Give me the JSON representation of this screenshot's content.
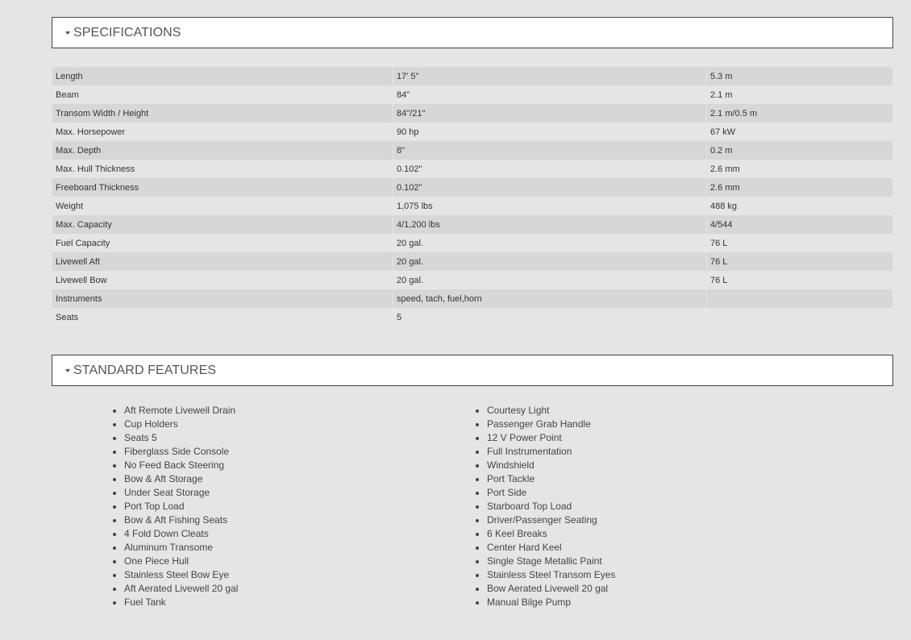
{
  "specifications": {
    "title": "SPECIFICATIONS",
    "rows": [
      {
        "label": "Length",
        "imperial": "17' 5\"",
        "metric": "5.3 m"
      },
      {
        "label": "Beam",
        "imperial": "84\"",
        "metric": "2.1 m"
      },
      {
        "label": "Transom Width / Height",
        "imperial": "84\"/21\"",
        "metric": "2.1 m/0.5 m"
      },
      {
        "label": "Max. Horsepower",
        "imperial": "90 hp",
        "metric": "67 kW"
      },
      {
        "label": "Max. Depth",
        "imperial": "8\"",
        "metric": "0.2 m"
      },
      {
        "label": "Max. Hull Thickness",
        "imperial": "0.102\"",
        "metric": "2.6 mm"
      },
      {
        "label": "Freeboard Thickness",
        "imperial": "0.102\"",
        "metric": "2.6 mm"
      },
      {
        "label": "Weight",
        "imperial": "1,075 lbs",
        "metric": "488 kg"
      },
      {
        "label": "Max. Capacity",
        "imperial": "4/1,200 lbs",
        "metric": "4/544"
      },
      {
        "label": "Fuel Capacity",
        "imperial": "20 gal.",
        "metric": "76 L"
      },
      {
        "label": "Livewell Aft",
        "imperial": "20 gal.",
        "metric": "76 L"
      },
      {
        "label": "Livewell Bow",
        "imperial": "20 gal.",
        "metric": "76 L"
      },
      {
        "label": "Instruments",
        "imperial": "speed, tach, fuel,horn",
        "metric": ""
      },
      {
        "label": "Seats",
        "imperial": "5",
        "metric": ""
      }
    ]
  },
  "standard_features": {
    "title": "STANDARD FEATURES",
    "left": [
      "Aft Remote Livewell Drain",
      "Cup Holders",
      "Seats 5",
      "Fiberglass Side Console",
      "No Feed Back Steering",
      "Bow & Aft Storage",
      "Under Seat Storage",
      "Port Top Load",
      "Bow & Aft Fishing Seats",
      "4 Fold Down Cleats",
      "Aluminum Transome",
      "One Piece Hull",
      "Stainless Steel Bow Eye",
      "Aft Aerated Livewell 20 gal",
      "Fuel Tank"
    ],
    "right": [
      "Courtesy Light",
      "Passenger Grab Handle",
      "12 V Power Point",
      "Full Instrumentation",
      "Windshield",
      "Port Tackle",
      "Port Side",
      "Starboard Top Load",
      "Driver/Passenger Seating",
      "6 Keel Breaks",
      "Center Hard Keel",
      "Single Stage Metallic Paint",
      "Stainless Steel Transom Eyes",
      "Bow Aerated Livewell 20 gal",
      "Manual Bilge Pump"
    ]
  },
  "icons": {
    "collapse_toggle": "caret-down-icon"
  },
  "colors": {
    "page_background": "#e5e5e5",
    "stripe": "#d7d7d7",
    "header_background": "#ffffff",
    "header_border": "#444444"
  }
}
